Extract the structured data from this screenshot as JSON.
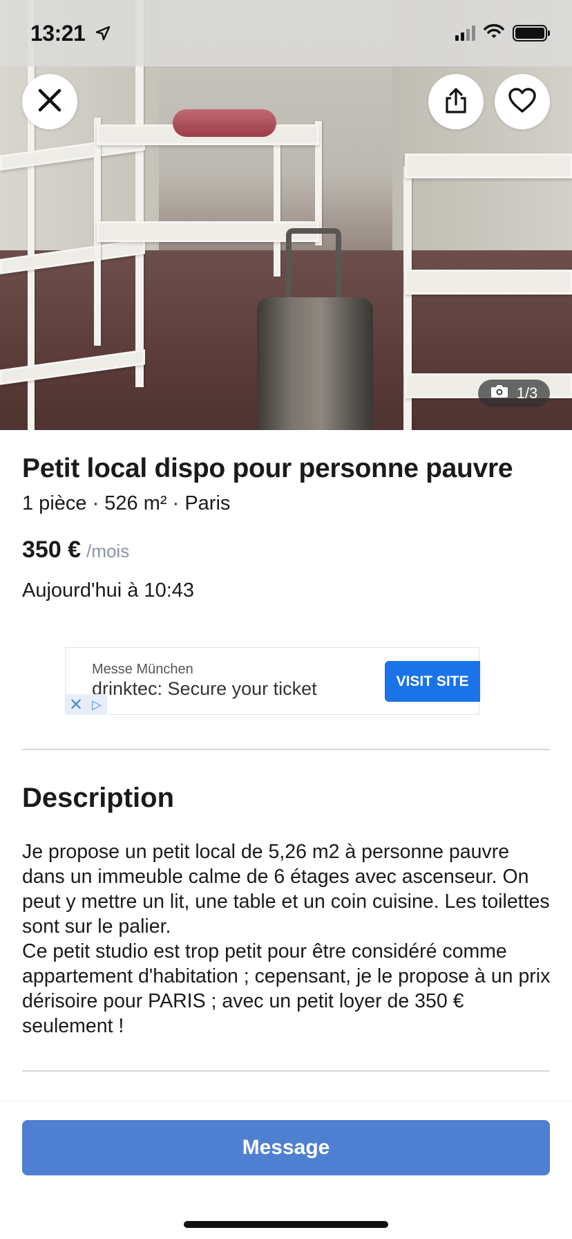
{
  "status_bar": {
    "time": "13:21",
    "location_icon": "location-arrow-icon",
    "icons": [
      "signal-icon",
      "wifi-icon",
      "battery-icon"
    ]
  },
  "photo": {
    "counter_icon": "camera-icon",
    "counter_text": "1/3",
    "description": "room with white metal shelves and a grey suitcase"
  },
  "header_buttons": {
    "close_icon": "close-icon",
    "share_icon": "share-icon",
    "favorite_icon": "heart-icon"
  },
  "listing": {
    "title": "Petit local dispo pour personne pauvre",
    "subtitle": "1 pièce · 526 m² · Paris",
    "price": "350 €",
    "price_unit": "/mois",
    "date": "Aujourd'hui à 10:43"
  },
  "ad": {
    "brand": "Messe München",
    "headline": "drinktec: Secure your ticket",
    "cta": "VISIT SITE",
    "close": "✕",
    "choices": "▷"
  },
  "description": {
    "title": "Description",
    "paragraph1": "Je propose un petit local de 5,26 m2 à personne pauvre dans un immeuble calme de 6 étages avec ascenseur. On peut y mettre un lit, une table et un coin cuisine. Les toilettes sont sur le palier.",
    "paragraph2": "Ce petit studio est trop petit pour être considéré comme appartement d'habitation ; cepensant, je le propose à un prix dérisoire pour PARIS ; avec un petit loyer de 350 € seulement !"
  },
  "actions": {
    "message_label": "Message"
  },
  "colors": {
    "primary_button": "#4f7fd1",
    "ad_cta": "#1a73e8",
    "muted_text": "#8a94a6"
  }
}
